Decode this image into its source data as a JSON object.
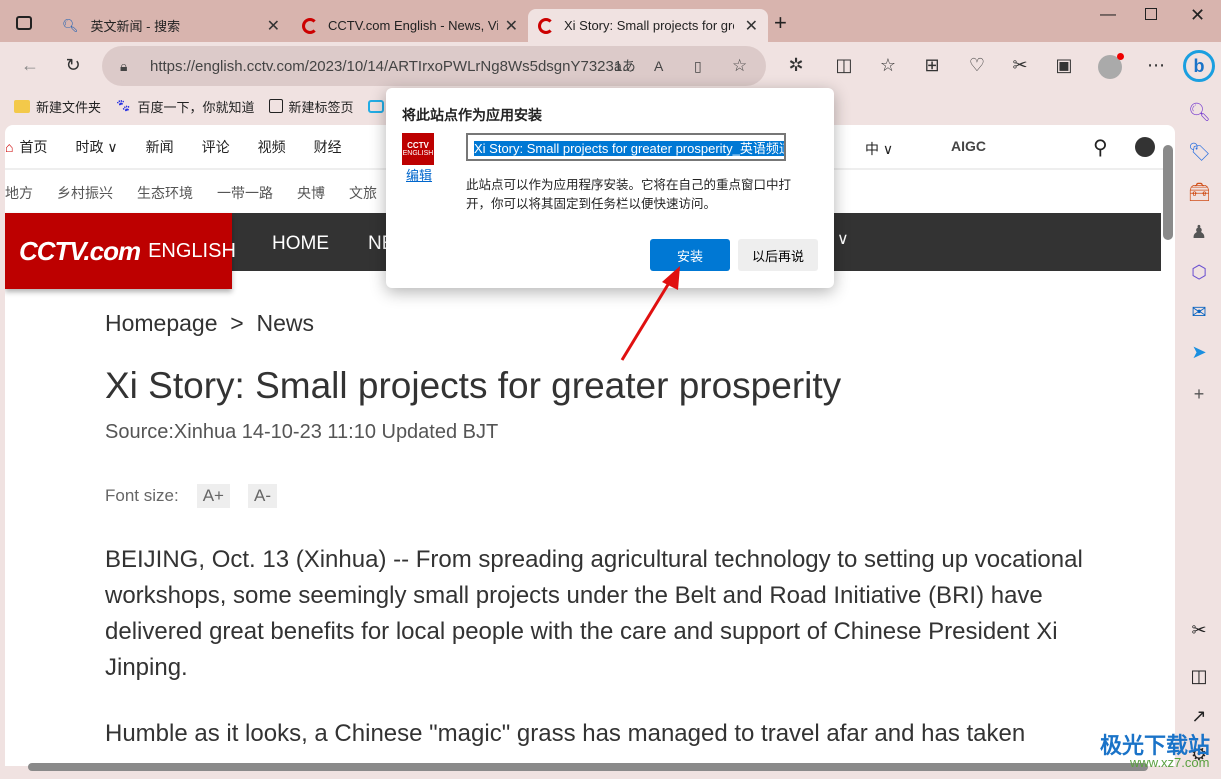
{
  "tabs": [
    {
      "label": "英文新闻 - 搜索"
    },
    {
      "label": "CCTV.com English - News, Video"
    },
    {
      "label": "Xi Story: Small projects for greater prosperity"
    }
  ],
  "address": "https://english.cctv.com/2023/10/14/ARTIrxoPWLrNg8Ws5dsgnY73231...",
  "bookmarks": [
    "新建文件夹",
    "百度一下，你就知道",
    "新建标签页"
  ],
  "nav1": [
    "首页",
    "时政 ∨",
    "新闻",
    "评论",
    "视频",
    "财经"
  ],
  "nav1_right": {
    "lang": "中 ∨",
    "aigc": "AIGC"
  },
  "nav2": [
    "地方",
    "乡村振兴",
    "生态环境",
    "一带一路",
    "央博",
    "文旅"
  ],
  "logo": {
    "brand": "CCTV.com",
    "text": "ENGLISH"
  },
  "dark_nav": [
    "HOME",
    "NEWS"
  ],
  "article": {
    "breadcrumb": "Homepage  >  News",
    "title": "Xi Story: Small projects for greater prosperity",
    "source": "Source:Xinhua 14-10-23 11:10 Updated BJT",
    "font_size_label": "Font size:",
    "font_plus": "A+",
    "font_minus": "A-",
    "p1": "BEIJING, Oct. 13 (Xinhua) -- From spreading agricultural technology to setting up vocational workshops, some seemingly small projects under the Belt and Road Initiative (BRI) have delivered great benefits for local people with the care and support of Chinese President Xi Jinping.",
    "p2": "Humble as it looks, a Chinese \"magic\" grass has managed to travel afar and has taken"
  },
  "dialog": {
    "title": "将此站点作为应用安装",
    "icon_text": "ENGLISH",
    "edit": "编辑",
    "name_value": "Xi Story: Small projects for greater prosperity_英语频道_央",
    "description": "此站点可以作为应用程序安装。它将在自己的重点窗口中打开，你可以将其固定到任务栏以便快速访问。",
    "install": "安装",
    "later": "以后再说"
  },
  "watermark": {
    "name": "极光下载站",
    "url": "www.xz7.com"
  },
  "colors": {
    "accent": "#0078d4",
    "brand": "#bd0000",
    "tabbar": "#d8b4ae"
  }
}
